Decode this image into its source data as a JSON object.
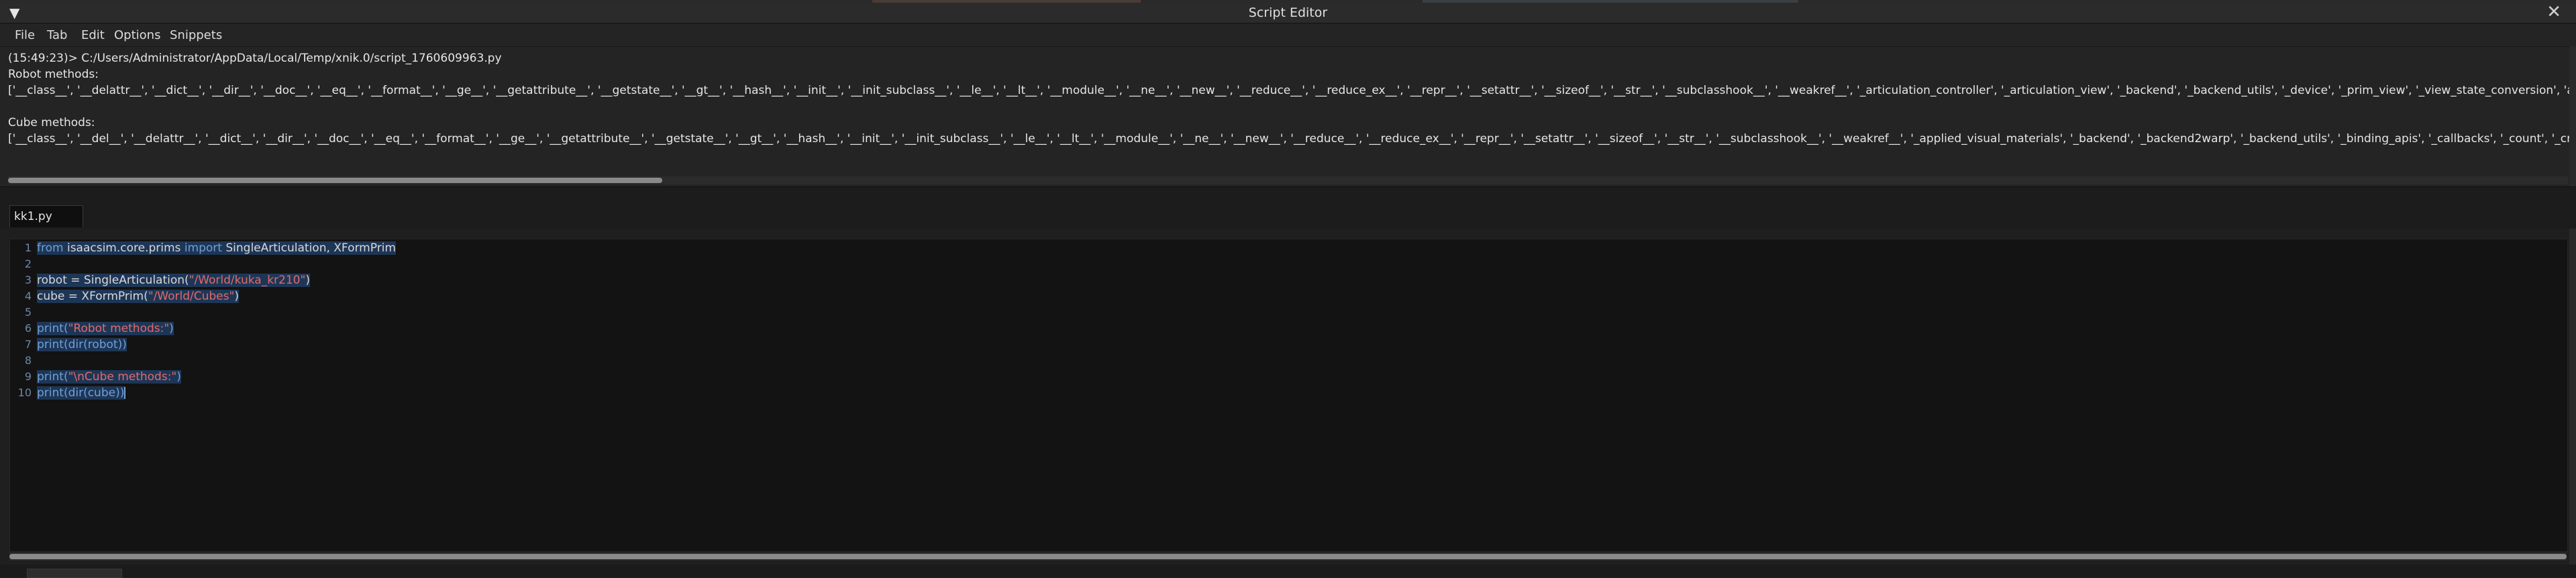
{
  "window": {
    "title": "Script Editor",
    "collapse_glyph": "▼",
    "close_glyph": "✕"
  },
  "menu": {
    "items": [
      "File",
      "Tab",
      "Edit",
      "Options",
      "Snippets"
    ]
  },
  "output": {
    "lines": [
      "(15:49:23)> C:/Users/Administrator/AppData/Local/Temp/xnik.0/script_1760609963.py",
      "Robot methods:",
      "['__class__', '__delattr__', '__dict__', '__dir__', '__doc__', '__eq__', '__format__', '__ge__', '__getattribute__', '__getstate__', '__gt__', '__hash__', '__init__', '__init_subclass__', '__le__', '__lt__', '__module__', '__ne__', '__new__', '__reduce__', '__reduce_ex__', '__repr__', '__setattr__', '__sizeof__', '__str__', '__subclasshook__', '__weakref__', '_articulation_controller', '_articulation_view', '_backend', '_backend_utils', '_device', '_prim_view', '_view_state_conversion', 'apply_acti",
      "",
      "Cube methods:",
      "['__class__', '__del__', '__delattr__', '__dict__', '__dir__', '__doc__', '__eq__', '__format__', '__ge__', '__getattribute__', '__getstate__', '__gt__', '__hash__', '__init__', '__init_subclass__', '__le__', '__lt__', '__module__', '__ne__', '__new__', '__reduce__', '__reduce_ex__', '__repr__', '__setattr__', '__sizeof__', '__str__', '__subclasshook__', '__weakref__', '_applied_visual_materials', '_backend', '_backend2warp', '_backend_utils', '_binding_apis', '_callbacks', '_count', '_create_fabric"
    ]
  },
  "tabs": [
    {
      "label": "kk1.py"
    }
  ],
  "editor": {
    "line_numbers": [
      "1",
      "2",
      "3",
      "4",
      "5",
      "6",
      "7",
      "8",
      "9",
      "10"
    ],
    "lines": {
      "l1_kw1": "from",
      "l1_mod": " isaacsim.core.prims ",
      "l1_kw2": "import",
      "l1_rest": " SingleArticulation, XFormPrim",
      "l3_pre": "robot = SingleArticulation(",
      "l3_str": "\"/World/kuka_kr210\"",
      "l3_post": ")",
      "l4_pre": "cube = XFormPrim(",
      "l4_str": "\"/World/Cubes\"",
      "l4_post": ")",
      "l6_pre": "print(",
      "l6_str": "\"Robot methods:\"",
      "l6_post": ")",
      "l7": "print(dir(robot))",
      "l9_pre": "print(",
      "l9_str": "\"\\nCube methods:\"",
      "l9_post": ")",
      "l10": "print(dir(cube))"
    }
  },
  "colors": {
    "keyword": "#6fa0d8",
    "string": "#e06a6a",
    "selection": "#1e3656",
    "background": "#131313"
  }
}
